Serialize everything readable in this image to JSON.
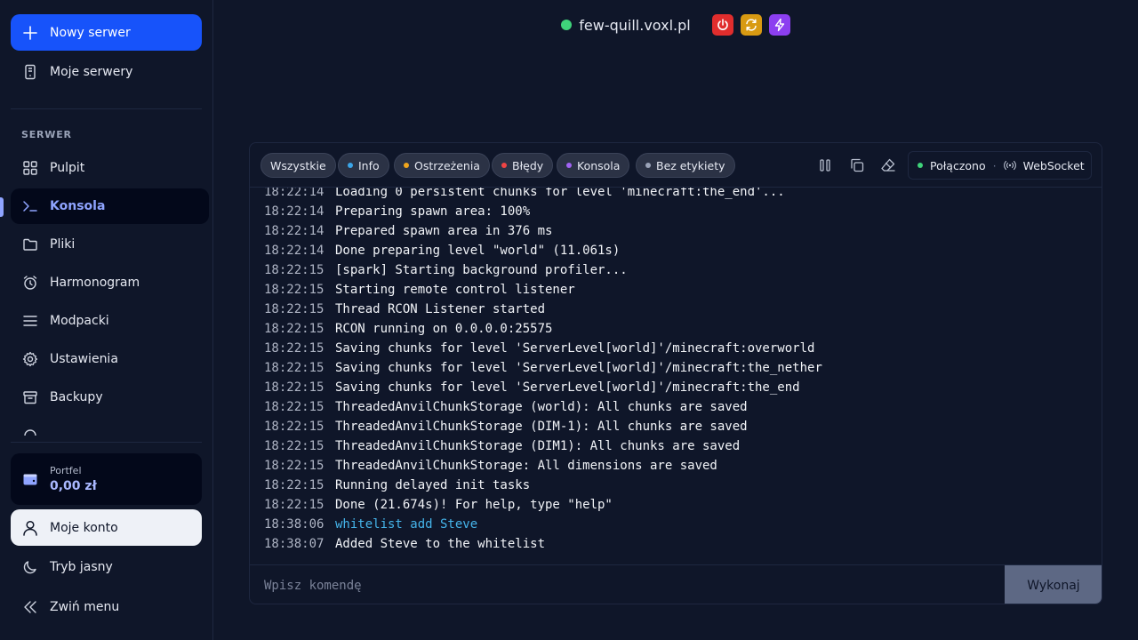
{
  "sidebar": {
    "new_server": "Nowy serwer",
    "my_servers": "Moje serwery",
    "section": "SERWER",
    "items": [
      {
        "label": "Pulpit"
      },
      {
        "label": "Konsola"
      },
      {
        "label": "Pliki"
      },
      {
        "label": "Harmonogram"
      },
      {
        "label": "Modpacki"
      },
      {
        "label": "Ustawienia"
      },
      {
        "label": "Backupy"
      }
    ],
    "wallet_label": "Portfel",
    "wallet_value": "0,00 zł",
    "account": "Moje konto",
    "theme": "Tryb jasny",
    "collapse": "Zwiń menu",
    "accent": "#1753fa"
  },
  "header": {
    "host": "few-quill.voxl.pl",
    "status_color": "#3fd37a",
    "buttons": [
      {
        "icon": "power-icon",
        "color": "#e02d2d"
      },
      {
        "icon": "restart-icon",
        "color": "#d89a12"
      },
      {
        "icon": "bolt-icon",
        "color": "#8c3ff0"
      }
    ]
  },
  "console": {
    "filters": [
      {
        "label": "Wszystkie",
        "color": ""
      },
      {
        "label": "Info",
        "color": "#3ba5e8"
      },
      {
        "label": "Ostrzeżenia",
        "color": "#f0a51c"
      },
      {
        "label": "Błędy",
        "color": "#ef4444"
      },
      {
        "label": "Konsola",
        "color": "#a163f2"
      },
      {
        "label": "Bez etykiety",
        "color": "#9aa3b8"
      }
    ],
    "connection": {
      "status": "Połączono",
      "transport": "WebSocket"
    },
    "lines": [
      {
        "ts": "18:22:14",
        "msg": "Loading 0 persistent chunks for level 'minecraft:the_end'..."
      },
      {
        "ts": "18:22:14",
        "msg": "Preparing spawn area: 100%"
      },
      {
        "ts": "18:22:14",
        "msg": "Prepared spawn area in 376 ms"
      },
      {
        "ts": "18:22:14",
        "msg": "Done preparing level \"world\" (11.061s)"
      },
      {
        "ts": "18:22:15",
        "msg": "[spark] Starting background profiler..."
      },
      {
        "ts": "18:22:15",
        "msg": "Starting remote control listener"
      },
      {
        "ts": "18:22:15",
        "msg": "Thread RCON Listener started"
      },
      {
        "ts": "18:22:15",
        "msg": "RCON running on 0.0.0.0:25575"
      },
      {
        "ts": "18:22:15",
        "msg": "Saving chunks for level 'ServerLevel[world]'/minecraft:overworld"
      },
      {
        "ts": "18:22:15",
        "msg": "Saving chunks for level 'ServerLevel[world]'/minecraft:the_nether"
      },
      {
        "ts": "18:22:15",
        "msg": "Saving chunks for level 'ServerLevel[world]'/minecraft:the_end"
      },
      {
        "ts": "18:22:15",
        "msg": "ThreadedAnvilChunkStorage (world): All chunks are saved"
      },
      {
        "ts": "18:22:15",
        "msg": "ThreadedAnvilChunkStorage (DIM-1): All chunks are saved"
      },
      {
        "ts": "18:22:15",
        "msg": "ThreadedAnvilChunkStorage (DIM1): All chunks are saved"
      },
      {
        "ts": "18:22:15",
        "msg": "ThreadedAnvilChunkStorage: All dimensions are saved"
      },
      {
        "ts": "18:22:15",
        "msg": "Running delayed init tasks"
      },
      {
        "ts": "18:22:15",
        "msg": "Done (21.674s)! For help, type \"help\""
      },
      {
        "ts": "18:38:06",
        "msg": "whitelist add Steve",
        "command": true
      },
      {
        "ts": "18:38:07",
        "msg": "Added Steve to the whitelist"
      }
    ],
    "input_placeholder": "Wpisz komendę",
    "execute": "Wykonaj"
  }
}
